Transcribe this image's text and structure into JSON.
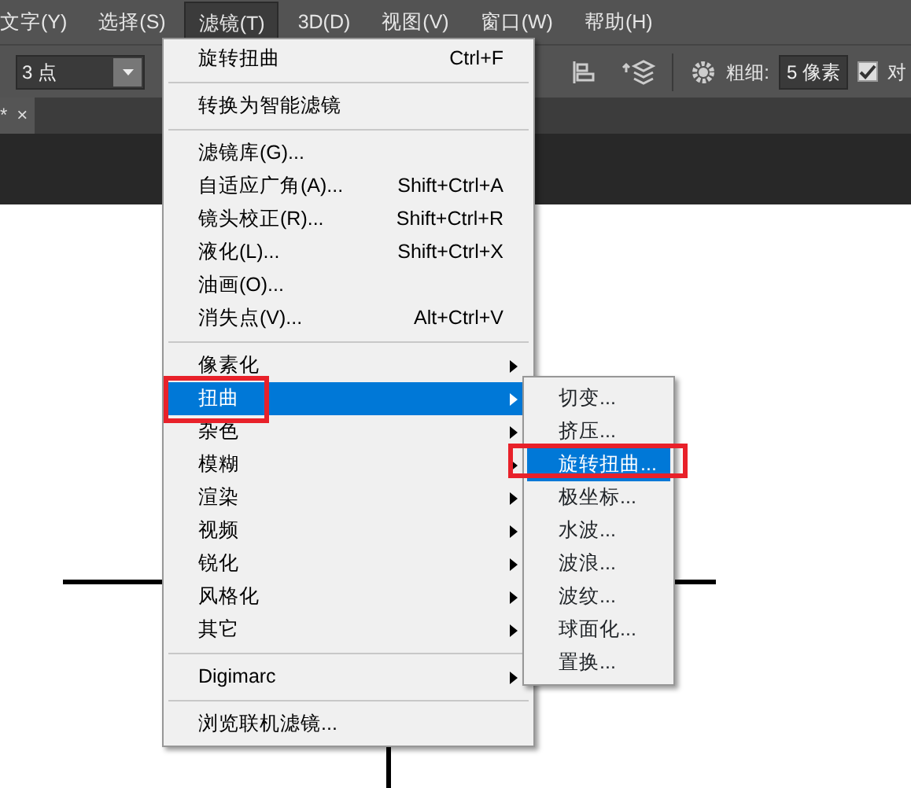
{
  "menubar": [
    {
      "label": "文字(Y)",
      "selected": false
    },
    {
      "label": "选择(S)",
      "selected": false
    },
    {
      "label": "滤镜(T)",
      "selected": true
    },
    {
      "label": "3D(D)",
      "selected": false
    },
    {
      "label": "视图(V)",
      "selected": false
    },
    {
      "label": "窗口(W)",
      "selected": false
    },
    {
      "label": "帮助(H)",
      "selected": false
    }
  ],
  "options_bar": {
    "size_select": "3 点",
    "weight_label": "粗细:",
    "weight_value": "5 像素",
    "align_checkbox": {
      "label": "对",
      "checked": true
    }
  },
  "document_tab": {
    "modified_mark": "*",
    "close": "×"
  },
  "filter_menu": {
    "items": [
      {
        "kind": "item",
        "label": "旋转扭曲",
        "shortcut": "Ctrl+F"
      },
      {
        "kind": "separator"
      },
      {
        "kind": "item",
        "label": "转换为智能滤镜"
      },
      {
        "kind": "separator"
      },
      {
        "kind": "item",
        "label": "滤镜库(G)..."
      },
      {
        "kind": "item",
        "label": "自适应广角(A)...",
        "shortcut": "Shift+Ctrl+A"
      },
      {
        "kind": "item",
        "label": "镜头校正(R)...",
        "shortcut": "Shift+Ctrl+R"
      },
      {
        "kind": "item",
        "label": "液化(L)...",
        "shortcut": "Shift+Ctrl+X"
      },
      {
        "kind": "item",
        "label": "油画(O)..."
      },
      {
        "kind": "item",
        "label": "消失点(V)...",
        "shortcut": "Alt+Ctrl+V"
      },
      {
        "kind": "separator"
      },
      {
        "kind": "submenu",
        "label": "像素化",
        "selected": false,
        "annotated": false
      },
      {
        "kind": "submenu",
        "label": "扭曲",
        "selected": true,
        "annotated": true
      },
      {
        "kind": "submenu",
        "label": "杂色",
        "selected": false,
        "annotated": false
      },
      {
        "kind": "submenu",
        "label": "模糊",
        "selected": false,
        "annotated": false
      },
      {
        "kind": "submenu",
        "label": "渲染",
        "selected": false,
        "annotated": false
      },
      {
        "kind": "submenu",
        "label": "视频",
        "selected": false,
        "annotated": false
      },
      {
        "kind": "submenu",
        "label": "锐化",
        "selected": false,
        "annotated": false
      },
      {
        "kind": "submenu",
        "label": "风格化",
        "selected": false,
        "annotated": false
      },
      {
        "kind": "submenu",
        "label": "其它",
        "selected": false,
        "annotated": false
      },
      {
        "kind": "separator"
      },
      {
        "kind": "submenu",
        "label": "Digimarc",
        "selected": false,
        "annotated": false
      },
      {
        "kind": "separator"
      },
      {
        "kind": "item",
        "label": "浏览联机滤镜..."
      }
    ]
  },
  "distort_submenu": {
    "items": [
      {
        "label": "切变...",
        "selected": false,
        "annotated": false
      },
      {
        "label": "挤压...",
        "selected": false,
        "annotated": false
      },
      {
        "label": "旋转扭曲...",
        "selected": true,
        "annotated": true
      },
      {
        "label": "极坐标...",
        "selected": false,
        "annotated": false
      },
      {
        "label": "水波...",
        "selected": false,
        "annotated": false
      },
      {
        "label": "波浪...",
        "selected": false,
        "annotated": false
      },
      {
        "label": "波纹...",
        "selected": false,
        "annotated": false
      },
      {
        "label": "球面化...",
        "selected": false,
        "annotated": false
      },
      {
        "label": "置换...",
        "selected": false,
        "annotated": false
      }
    ]
  }
}
